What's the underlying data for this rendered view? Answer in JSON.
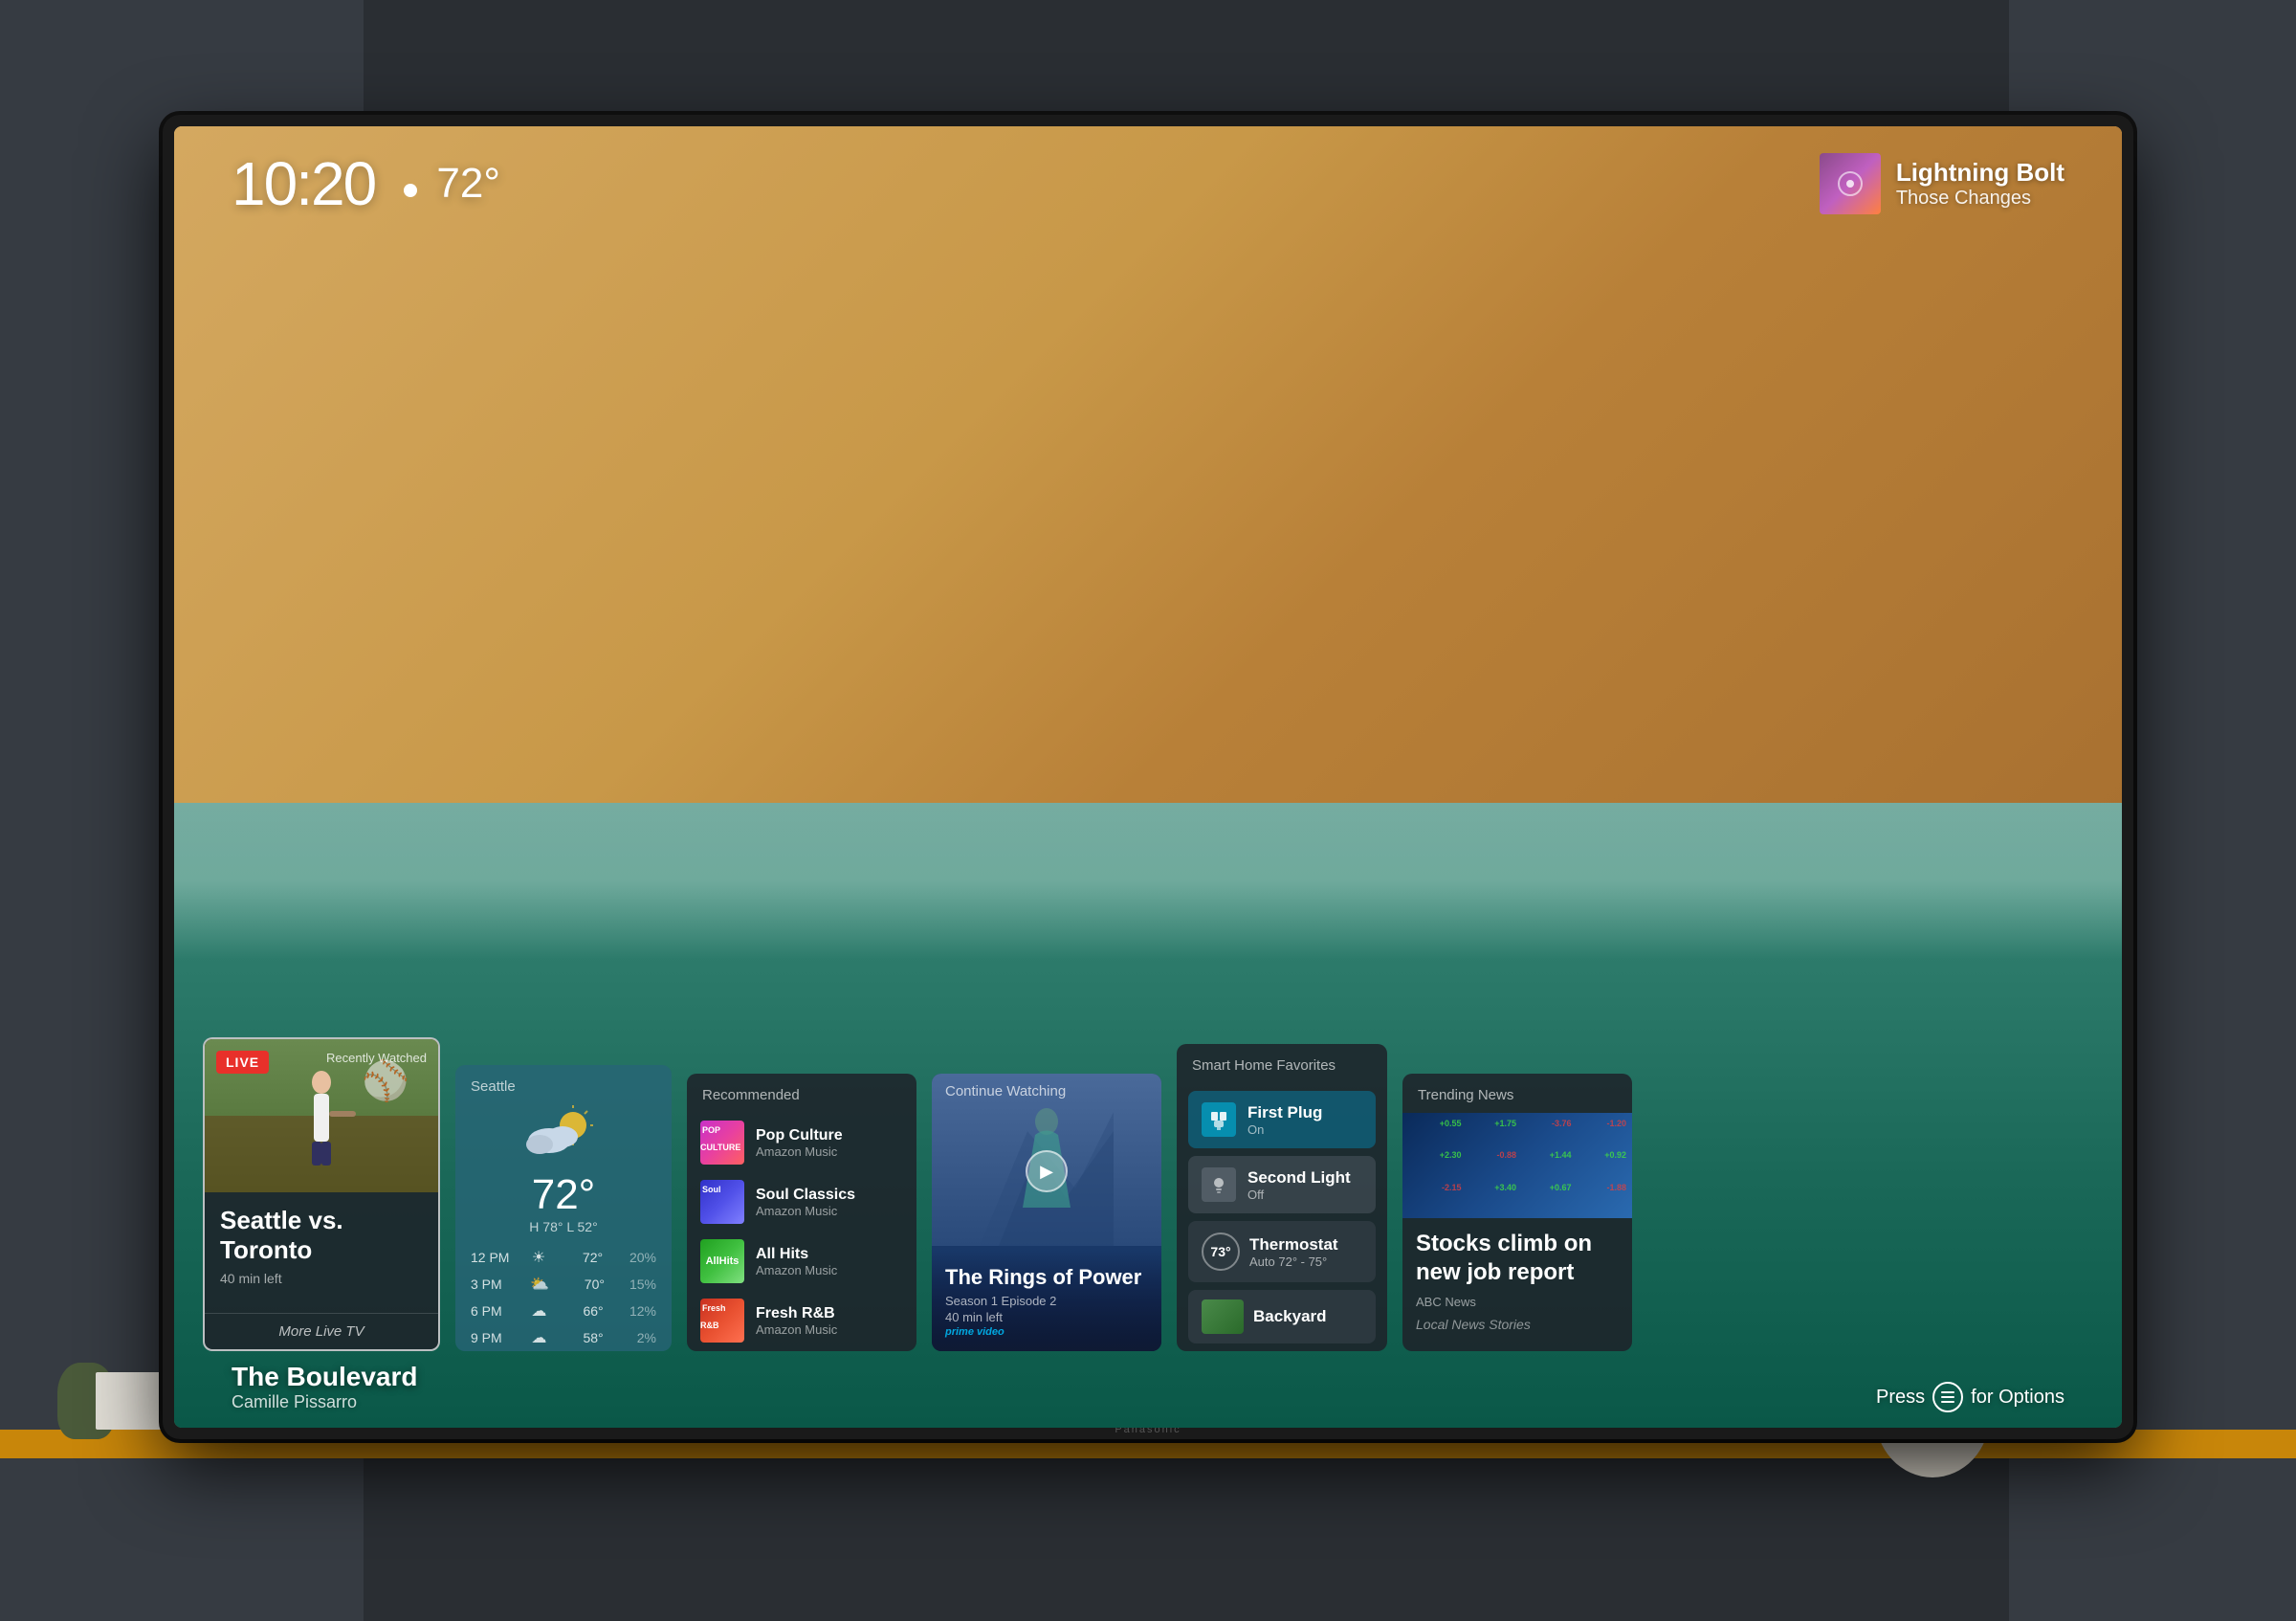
{
  "tv": {
    "brand": "Panasonic"
  },
  "screen": {
    "time": "10:20",
    "temperature": "72°",
    "weather_dot": true,
    "now_playing": {
      "title": "Lightning Bolt",
      "artist": "Those Changes"
    },
    "artwork": {
      "title": "The Boulevard",
      "artist": "Camille Pissarro"
    },
    "options_hint": "Press",
    "options_hint2": "for Options"
  },
  "cards": {
    "recently_watched": {
      "label": "Recently Watched",
      "live_badge": "LIVE",
      "title": "Seattle vs. Toronto",
      "time_left": "40 min left",
      "footer_link": "More Live TV"
    },
    "weather": {
      "location": "Seattle",
      "temp": "72°",
      "hi_lo": "H 78° L 52°",
      "forecast": [
        {
          "time": "12 PM",
          "icon": "☀",
          "temp": "72°",
          "pct": "20%"
        },
        {
          "time": "3 PM",
          "icon": "⛅",
          "temp": "70°",
          "pct": "15%"
        },
        {
          "time": "6 PM",
          "icon": "☁",
          "temp": "66°",
          "pct": "12%"
        },
        {
          "time": "9 PM",
          "icon": "☁",
          "temp": "58°",
          "pct": "2%"
        }
      ]
    },
    "recommended": {
      "label": "Recommended",
      "items": [
        {
          "name": "Pop Culture",
          "source": "Amazon Music",
          "thumb": "popculture"
        },
        {
          "name": "Soul Classics",
          "source": "Amazon Music",
          "thumb": "soul"
        },
        {
          "name": "All Hits",
          "source": "Amazon Music",
          "thumb": "allhits"
        },
        {
          "name": "Fresh R&B",
          "source": "Amazon Music",
          "thumb": "freshrb"
        }
      ]
    },
    "continue_watching": {
      "label": "Continue Watching",
      "title": "The Rings of Power",
      "episode": "Season 1 Episode 2",
      "time_left": "40 min left",
      "service": "prime video"
    },
    "smart_home": {
      "label": "Smart Home Favorites",
      "devices": [
        {
          "name": "First Plug",
          "status": "On",
          "state": "on"
        },
        {
          "name": "Second Light",
          "status": "Off",
          "state": "off"
        },
        {
          "name": "Thermostat",
          "temp": "73°",
          "setting": "Auto 72° - 75°",
          "type": "thermostat"
        },
        {
          "name": "Backyard",
          "type": "camera"
        }
      ]
    },
    "trending_news": {
      "label": "Trending News",
      "headline": "Stocks climb on new job report",
      "source": "ABC News",
      "link": "Local News Stories",
      "tickers": [
        {
          "label": "+0.55",
          "up": true
        },
        {
          "label": "+1.75",
          "up": true
        },
        {
          "label": "-3.76",
          "up": false
        },
        {
          "label": "-1.20",
          "up": false
        },
        {
          "label": "+2.30",
          "up": true
        },
        {
          "label": "-0.88",
          "up": false
        },
        {
          "label": "+1.44",
          "up": true
        },
        {
          "label": "+0.92",
          "up": true
        }
      ]
    }
  }
}
